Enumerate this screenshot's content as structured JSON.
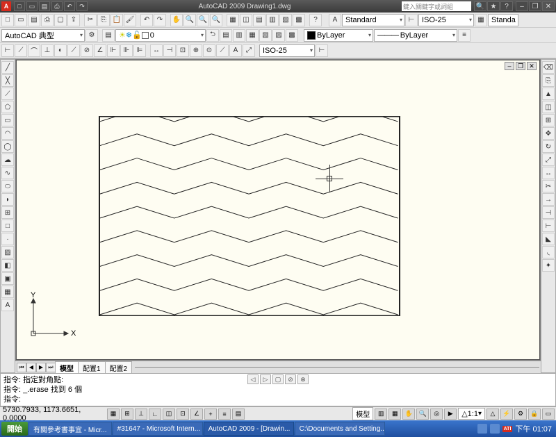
{
  "titlebar": {
    "app_title": "AutoCAD 2009  Drawing1.dwg",
    "search_placeholder": "鍵入關鍵字或詞組",
    "qat": [
      "□",
      "⮌",
      "⮎",
      "🖶",
      "≣"
    ]
  },
  "toolbar_row1": {
    "style_dropdown1": "Standard",
    "style_dropdown2": "ISO-25",
    "style_dropdown3": "Standa"
  },
  "toolbar_row2": {
    "workspace": "AutoCAD 典型",
    "layer_state": "0",
    "layer_prop": "ByLayer",
    "lineweight": "ByLayer"
  },
  "toolbar_row3": {
    "dimstyle": "ISO-25"
  },
  "left_tools": [
    "╱",
    "╱",
    "⎕",
    "◯",
    "◠",
    "∿",
    "◯",
    "⋯",
    "□",
    "⊡",
    "⊞",
    "◫",
    "⬚",
    "A"
  ],
  "right_tools": [
    "◆",
    "△",
    "▽",
    "◫",
    "⊞",
    "◈",
    "◎",
    "⊡",
    "⊥",
    "∠",
    "⊿",
    "◫",
    "◐",
    "◑",
    "⊡",
    "◫",
    "⊞",
    "⊟"
  ],
  "canvas": {
    "ucs_x": "X",
    "ucs_y": "Y"
  },
  "tabs": {
    "model": "模型",
    "layout1": "配置1",
    "layout2": "配置2"
  },
  "command": {
    "line1": "指令: 指定對角點:",
    "line2": "指令: _.erase 找到 6 個",
    "prompt": "指令:",
    "nav": [
      "◁",
      "▷",
      "▢",
      "⊘",
      "⊗"
    ]
  },
  "status": {
    "coords": "5730.7933, 1173.6651, 0.0000",
    "toggles": [
      "▦",
      "⊞",
      "⊥",
      "∟",
      "◫",
      "⊡",
      "⊞",
      "◫",
      "⊡",
      "◫",
      "⊡"
    ],
    "model_btn": "模型",
    "zoom": "1:1",
    "anno": "△"
  },
  "taskbar": {
    "start": "開始",
    "tasks": [
      "有關參考書事宜 - Micr...",
      "#31647 - Microsoft Intern...",
      "AutoCAD 2009 - [Drawin...",
      "C:\\Documents and Setting..."
    ],
    "active_task_index": 2,
    "ati": "ATI",
    "clock": "下午 01:07"
  }
}
